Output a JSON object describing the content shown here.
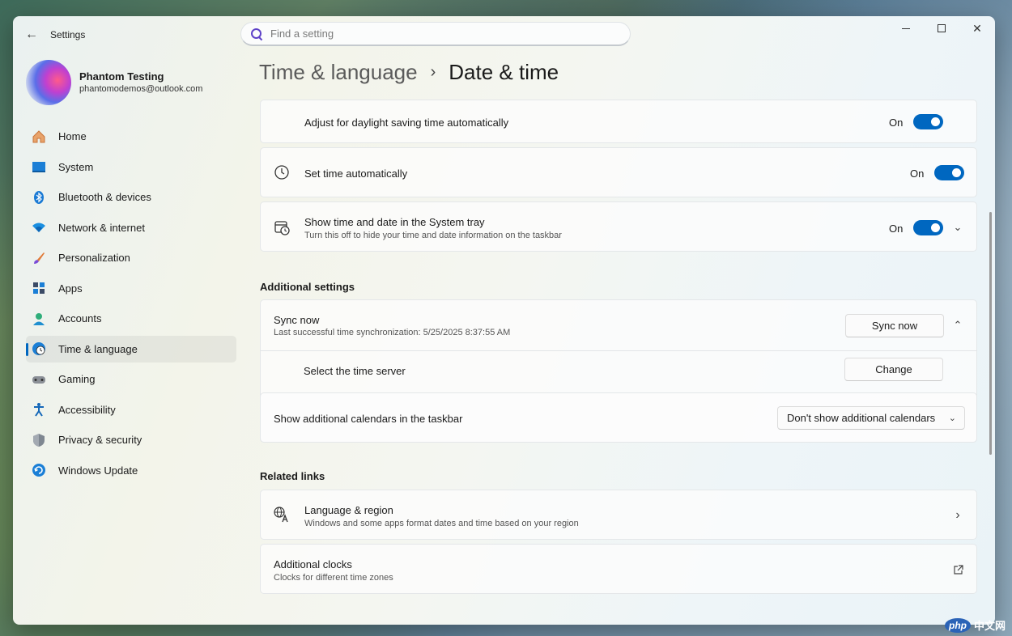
{
  "app": {
    "title": "Settings"
  },
  "search": {
    "placeholder": "Find a setting"
  },
  "profile": {
    "name": "Phantom Testing",
    "email": "phantomodemos@outlook.com"
  },
  "nav": {
    "items": [
      {
        "label": "Home",
        "icon": "home-icon"
      },
      {
        "label": "System",
        "icon": "system-icon"
      },
      {
        "label": "Bluetooth & devices",
        "icon": "bluetooth-icon"
      },
      {
        "label": "Network & internet",
        "icon": "network-icon"
      },
      {
        "label": "Personalization",
        "icon": "brush-icon"
      },
      {
        "label": "Apps",
        "icon": "apps-icon"
      },
      {
        "label": "Accounts",
        "icon": "accounts-icon"
      },
      {
        "label": "Time & language",
        "icon": "globe-clock-icon",
        "active": true
      },
      {
        "label": "Gaming",
        "icon": "gamepad-icon"
      },
      {
        "label": "Accessibility",
        "icon": "accessibility-icon"
      },
      {
        "label": "Privacy & security",
        "icon": "shield-icon"
      },
      {
        "label": "Windows Update",
        "icon": "update-icon"
      }
    ]
  },
  "breadcrumb": {
    "parent": "Time & language",
    "separator": "›",
    "current": "Date & time"
  },
  "settings": {
    "daylight": {
      "title": "Adjust for daylight saving time automatically",
      "state": "On"
    },
    "set_time": {
      "title": "Set time automatically",
      "state": "On"
    },
    "tray": {
      "title": "Show time and date in the System tray",
      "subtitle": "Turn this off to hide your time and date information on the taskbar",
      "state": "On"
    }
  },
  "additional": {
    "heading": "Additional settings",
    "sync": {
      "title": "Sync now",
      "subtitle": "Last successful time synchronization: 5/25/2025 8:37:55 AM",
      "button": "Sync now"
    },
    "server": {
      "title": "Select the time server",
      "button": "Change"
    },
    "calendars": {
      "title": "Show additional calendars in the taskbar",
      "selected": "Don't show additional calendars"
    }
  },
  "related": {
    "heading": "Related links",
    "language": {
      "title": "Language & region",
      "subtitle": "Windows and some apps format dates and time based on your region"
    },
    "clocks": {
      "title": "Additional clocks",
      "subtitle": "Clocks for different time zones"
    }
  },
  "watermark": {
    "badge": "php",
    "text": "中文网"
  },
  "colors": {
    "accent": "#0067c0"
  }
}
